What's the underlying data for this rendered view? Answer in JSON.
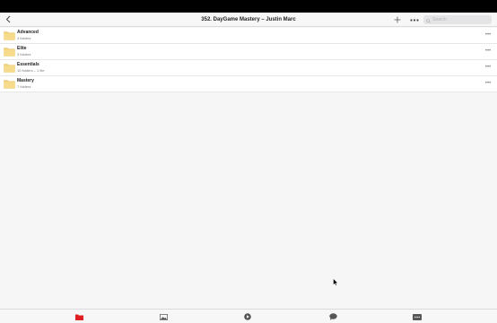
{
  "header": {
    "title": "352. DayGame Mastery – Justin Marc",
    "search_placeholder": "Search",
    "icons": {
      "back": "chevron-left-icon",
      "add": "plus-icon",
      "more": "ellipsis-icon",
      "search": "search-icon"
    }
  },
  "folders": [
    {
      "name": "Advanced",
      "details": "4 folders"
    },
    {
      "name": "Elite",
      "details": "3 folders"
    },
    {
      "name": "Essentials",
      "details": "10 folders – 1 file"
    },
    {
      "name": "Mastery",
      "details": "7 folders"
    }
  ],
  "row_more_label": "•••",
  "tabbar": {
    "tabs": [
      {
        "id": "files",
        "icon": "folder-icon",
        "active": true
      },
      {
        "id": "photos",
        "icon": "image-icon",
        "active": false
      },
      {
        "id": "media",
        "icon": "play-circle-icon",
        "active": false
      },
      {
        "id": "chat",
        "icon": "chat-bubble-icon",
        "active": false
      },
      {
        "id": "more",
        "icon": "more-box-icon",
        "active": false
      }
    ]
  },
  "colors": {
    "accent": "#e02020",
    "folder": "#f3d27a",
    "folder_dark": "#e6bf5e",
    "icon_gray": "#555555"
  }
}
